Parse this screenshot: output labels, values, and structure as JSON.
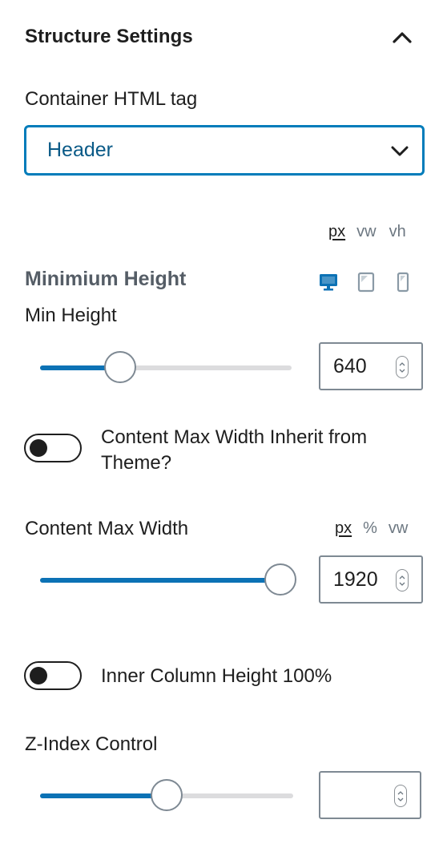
{
  "panel": {
    "title": "Structure Settings",
    "collapse_icon": "chevron-up-icon"
  },
  "container_tag": {
    "label": "Container HTML tag",
    "selected": "Header",
    "icon": "chevron-down-icon"
  },
  "min_height": {
    "units": [
      "px",
      "vw",
      "vh"
    ],
    "active_unit": "px",
    "heading": "Minimium Height",
    "devices": [
      "desktop-icon",
      "tablet-icon",
      "mobile-icon"
    ],
    "active_device": "desktop",
    "label": "Min Height",
    "value": "640",
    "slider_fraction": 0.32
  },
  "content_max_width_inherit": {
    "label": "Content Max Width Inherit from Theme?",
    "enabled": false
  },
  "content_max_width": {
    "label": "Content Max Width",
    "units": [
      "px",
      "%",
      "vw"
    ],
    "active_unit": "px",
    "value": "1920",
    "slider_fraction": 1.0
  },
  "inner_column_height": {
    "label": "Inner Column Height 100%",
    "enabled": false
  },
  "z_index": {
    "label": "Z-Index Control",
    "value": "",
    "slider_fraction": 0.5
  },
  "colors": {
    "accent": "#007cba",
    "slider_fill": "#0c72b5",
    "heading_gray": "#555d66"
  }
}
